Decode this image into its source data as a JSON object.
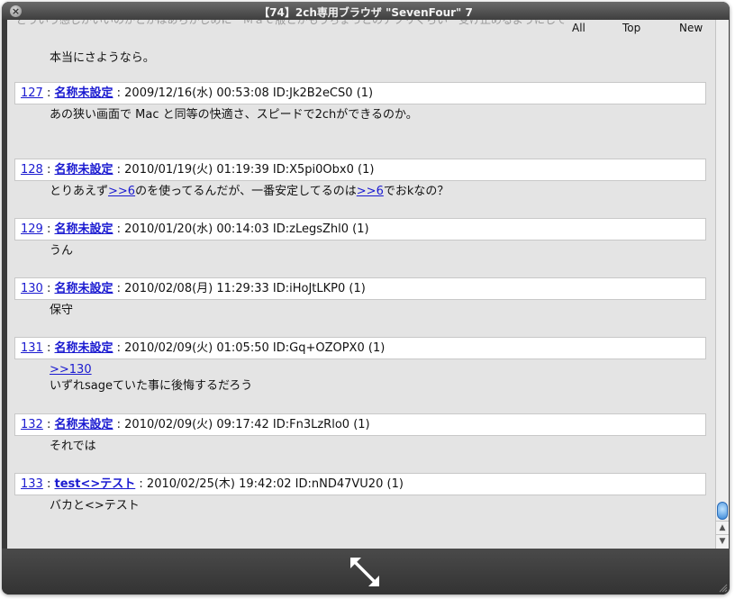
{
  "window": {
    "title": "【74】2ch専用ブラウザ \"SevenFour\" 7"
  },
  "nav": {
    "all": "All",
    "top": "Top",
    "new": "New"
  },
  "clipped_line": "どういう感じがいいのかとかはあらかじめに　Ｍａｃ版とかもうちょっとのアプリぐらい　受け止めるようにして",
  "previous_tail": "本当にさようなら。",
  "posts": [
    {
      "number": "127",
      "name": "名称未設定",
      "date": "2009/12/16(水) 00:53:08",
      "id": "ID:Jk2B2eCS0",
      "count": "(1)",
      "body": "あの狭い画面で Mac と同等の快適さ、スピードで2chができるのか。"
    },
    {
      "number": "128",
      "name": "名称未設定",
      "date": "2010/01/19(火) 01:19:39",
      "id": "ID:X5pi0Obx0",
      "count": "(1)",
      "body_a": "とりあえず",
      "anchor_1": ">>6",
      "body_b": "のを使ってるんだが、一番安定してるのは",
      "anchor_2": ">>6",
      "body_c": "でおkなの？"
    },
    {
      "number": "129",
      "name": "名称未設定",
      "date": "2010/01/20(水) 00:14:03",
      "id": "ID:zLegsZhl0",
      "count": "(1)",
      "body": "うん"
    },
    {
      "number": "130",
      "name": "名称未設定",
      "date": "2010/02/08(月) 11:29:33",
      "id": "ID:iHoJtLKP0",
      "count": "(1)",
      "body": "保守"
    },
    {
      "number": "131",
      "name": "名称未設定",
      "date": "2010/02/09(火) 01:05:50",
      "id": "ID:Gq+OZOPX0",
      "count": "(1)",
      "anchor": ">>130",
      "body": "いずれsageていた事に後悔するだろう"
    },
    {
      "number": "132",
      "name": "名称未設定",
      "date": "2010/02/09(火) 09:17:42",
      "id": "ID:Fn3LzRlo0",
      "count": "(1)",
      "body": "それでは"
    },
    {
      "number": "133",
      "name": "test<>テスト",
      "date": "2010/02/25(木) 19:42:02",
      "id": "ID:nND47VU20",
      "count": "(1)",
      "body": "バカと<>テスト"
    }
  ],
  "colors": {
    "link": "#1a1ad0",
    "background": "#e4e4e4",
    "bottom_bar": "#3a3a3a"
  },
  "icons": {
    "close": "close-icon",
    "resize": "expand-arrows-icon",
    "grip": "resize-grip-icon"
  }
}
